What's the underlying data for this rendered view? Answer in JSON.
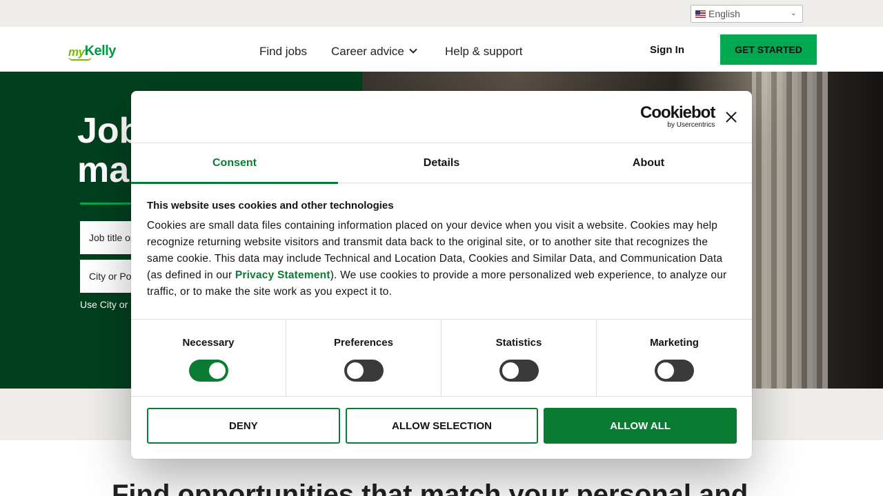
{
  "language": {
    "selected": "English"
  },
  "header": {
    "logo_my": "my",
    "logo_kelly": "Kelly",
    "nav": [
      "Find jobs",
      "Career advice",
      "Help & support"
    ],
    "sign_in": "Sign In",
    "get_started": "GET STARTED"
  },
  "hero": {
    "title": "Job\nma",
    "job_input_placeholder": "Job title or",
    "city_input_placeholder": "City or Po",
    "hint": "Use City or"
  },
  "section": {
    "heading": "Find opportunities that match your personal and"
  },
  "cookie_dialog": {
    "brand": "Cookiebot",
    "brand_sub": "by Usercentrics",
    "tabs": [
      "Consent",
      "Details",
      "About"
    ],
    "active_tab": "Consent",
    "heading": "This website uses cookies and other technologies",
    "body_part1": "Cookies are small data files containing information placed on your device when you visit a website. Cookies may help recognize returning website visitors and transmit data back to the original site, or to another site that recognizes the same cookie. This data may include Technical and Location Data, Cookies and Similar Data, and Communication Data (as defined in our ",
    "privacy_link": "Privacy Statement",
    "body_part2": "). We use cookies to provide a more personalized web experience, to analyze our traffic, or to make the site work as you expect it to.",
    "toggles": [
      {
        "label": "Necessary",
        "on": true
      },
      {
        "label": "Preferences",
        "on": false
      },
      {
        "label": "Statistics",
        "on": false
      },
      {
        "label": "Marketing",
        "on": false
      }
    ],
    "buttons": {
      "deny": "DENY",
      "allow_selection": "ALLOW SELECTION",
      "allow_all": "ALLOW ALL"
    }
  },
  "colors": {
    "brand_green": "#00a94f",
    "dialog_green": "#0b7a32",
    "hero_dark": "#00401f"
  }
}
